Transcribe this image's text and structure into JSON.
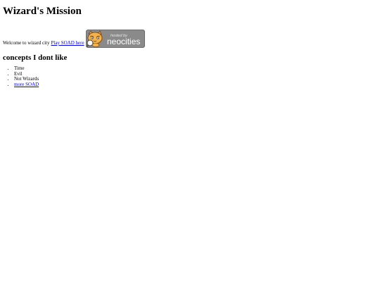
{
  "page": {
    "title": "Wizard's Mission",
    "intro_text": "Welcome to wizard city",
    "soad_link": "Play SOAD here",
    "badge": {
      "small_text": "hosted by",
      "brand_text": "neocities",
      "icon": "neocities-cat-logo",
      "bg_color": "#8a8a8a"
    },
    "section_heading": "concepts I dont like",
    "list_items": [
      {
        "label": "Time"
      },
      {
        "label": "Evil"
      },
      {
        "label": "Not Wizards"
      }
    ],
    "more_link": "more SOAD",
    "link_color": "#0000ee"
  }
}
